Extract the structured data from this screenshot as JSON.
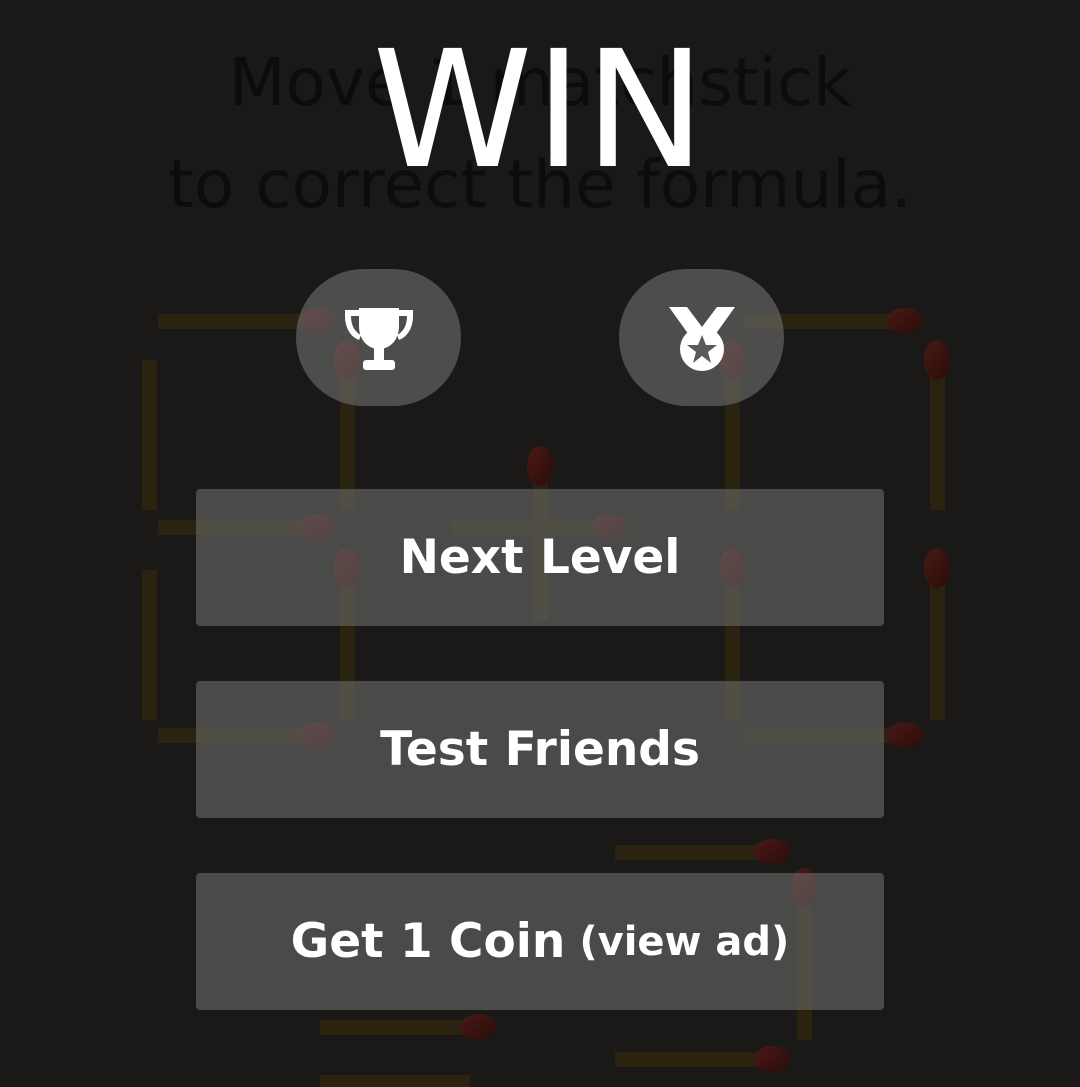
{
  "background": {
    "instruction_line1": "Move 1 matchstick",
    "instruction_line2": "to correct the formula."
  },
  "overlay": {
    "title": "WIN",
    "icons": {
      "leaderboard": "trophy-icon",
      "achievements": "medal-icon"
    },
    "buttons": {
      "next_level": "Next Level",
      "test_friends": "Test Friends",
      "get_coin": "Get 1 Coin",
      "get_coin_suffix": "(view ad)"
    }
  },
  "colors": {
    "background": "#1a1918",
    "button_fill": "#737373",
    "text": "#ffffff",
    "match_stick": "#2a2410",
    "match_head": "#3a1512"
  }
}
